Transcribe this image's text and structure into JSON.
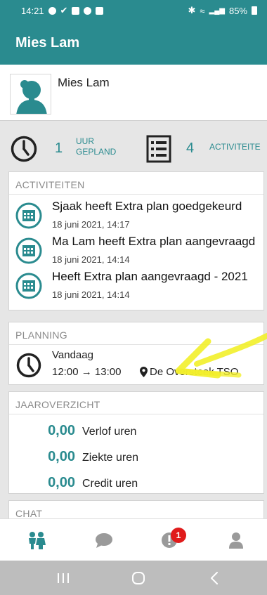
{
  "status_bar": {
    "time": "14:21",
    "battery": "85%"
  },
  "app_bar": {
    "title": "Mies Lam"
  },
  "profile": {
    "name": "Mies Lam"
  },
  "stats": {
    "hours_value": "1",
    "hours_label_line1": "UUR",
    "hours_label_line2": "GEPLAND",
    "activities_value": "4",
    "activities_label": "ACTIVITEITE"
  },
  "activities": {
    "title": "ACTIVITEITEN",
    "items": [
      {
        "text": "Sjaak heeft Extra plan goedgekeurd",
        "date": "18 juni 2021, 14:17"
      },
      {
        "text": "Ma Lam heeft Extra plan aangevraagd",
        "date": "18 juni 2021, 14:14"
      },
      {
        "text": "Heeft Extra plan aangevraagd - 2021",
        "date": "18 juni 2021, 14:14"
      }
    ]
  },
  "planning": {
    "title": "PLANNING",
    "day": "Vandaag",
    "start": "12:00",
    "arrow": "→",
    "end": "13:00",
    "location": "De Oversteek TSO"
  },
  "year_overview": {
    "title": "JAAROVERZICHT",
    "rows": [
      {
        "value": "0,00",
        "label": "Verlof uren"
      },
      {
        "value": "0,00",
        "label": "Ziekte uren"
      },
      {
        "value": "0,00",
        "label": "Credit uren"
      }
    ]
  },
  "chat": {
    "title": "CHAT"
  },
  "bottom_nav": {
    "items": [
      {
        "icon": "children-icon",
        "active": true
      },
      {
        "icon": "chat-bubble-icon",
        "active": false
      },
      {
        "icon": "alert-icon",
        "badge": "1",
        "active": false
      },
      {
        "icon": "person-icon",
        "active": false
      }
    ]
  },
  "colors": {
    "primary": "#2a8b8f",
    "badge": "#e01b1b",
    "highlight": "#f2ef2a"
  }
}
